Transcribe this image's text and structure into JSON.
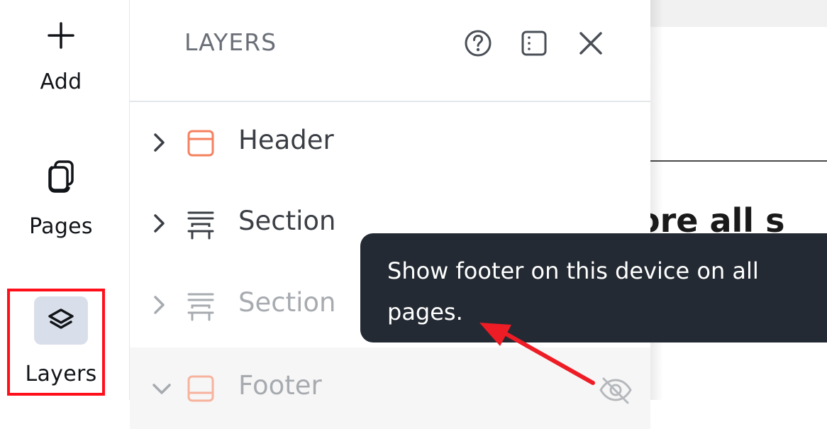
{
  "rail": {
    "add": {
      "label": "Add",
      "icon": "plus-icon"
    },
    "pages": {
      "label": "Pages",
      "icon": "pages-icon"
    },
    "layers": {
      "label": "Layers",
      "icon": "layers-icon",
      "active": true
    }
  },
  "panel": {
    "title": "LAYERS",
    "header_icons": [
      "help-icon",
      "panel-toggle-icon",
      "close-icon"
    ],
    "rows": [
      {
        "label": "Header",
        "icon": "header-icon",
        "expanded": false,
        "dimmed": false
      },
      {
        "label": "Section",
        "icon": "section-icon",
        "expanded": false,
        "dimmed": false
      },
      {
        "label": "Section",
        "icon": "section-icon",
        "expanded": false,
        "dimmed": true
      },
      {
        "label": "Footer",
        "icon": "footer-icon",
        "expanded": true,
        "dimmed": true,
        "hidden": true
      }
    ]
  },
  "canvas": {
    "heading_fragment": "ore all s"
  },
  "tooltip": {
    "text": "Show footer on this device on all pages."
  },
  "colors": {
    "accent_orange": "#f4815f",
    "tooltip_bg": "#242a33",
    "highlight_red": "#ff0f1a",
    "active_item_bg": "#d9dfea"
  }
}
